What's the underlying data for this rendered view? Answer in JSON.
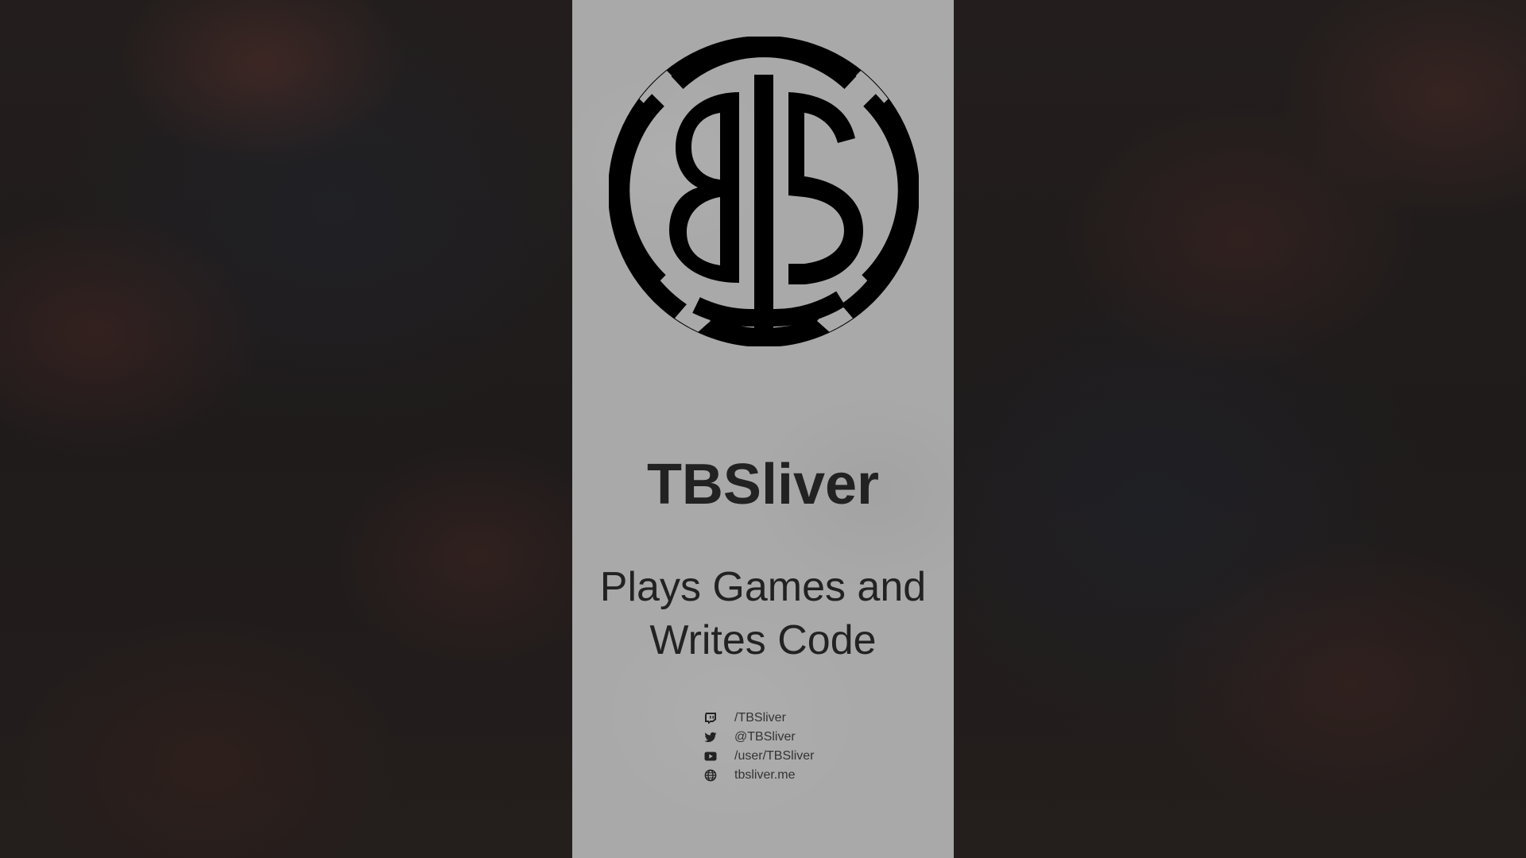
{
  "profile": {
    "logo_text": "BTS",
    "name": "TBSliver",
    "tagline_line1": "Plays Games and",
    "tagline_line2": "Writes Code"
  },
  "links": [
    {
      "icon": "twitch-icon",
      "label": "/TBSliver"
    },
    {
      "icon": "twitter-icon",
      "label": "@TBSliver"
    },
    {
      "icon": "youtube-icon",
      "label": "/user/TBSliver"
    },
    {
      "icon": "globe-icon",
      "label": "tbsliver.me"
    }
  ],
  "colors": {
    "background": "#221d1c",
    "panel": "#a9a9a9",
    "text": "#222222",
    "logo": "#000000"
  }
}
